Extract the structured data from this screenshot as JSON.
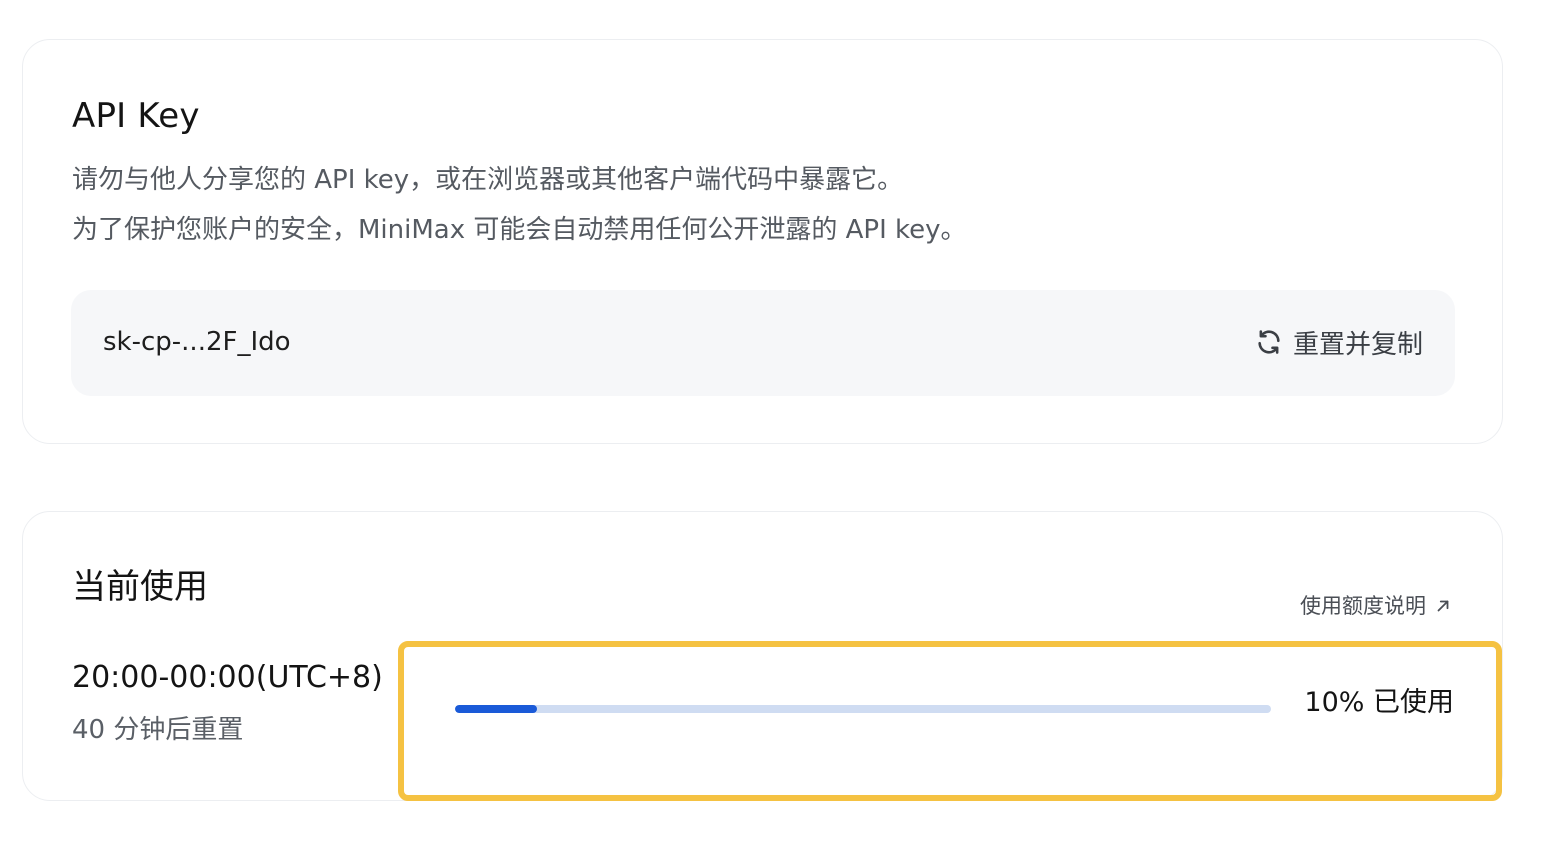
{
  "api_key_card": {
    "title": "API Key",
    "description_line1": "请勿与他人分享您的 API key，或在浏览器或其他客户端代码中暴露它。",
    "description_line2": "为了保护您账户的安全，MiniMax 可能会自动禁用任何公开泄露的 API key。",
    "key_value": "sk-cp-...2F_Ido",
    "reset_button_label": "重置并复制",
    "reset_icon": "refresh-icon"
  },
  "usage_card": {
    "title": "当前使用",
    "quota_link_label": "使用额度说明",
    "quota_link_icon": "arrow-up-right-icon",
    "time_range": "20:00-00:00(UTC+8)",
    "reset_hint": "40 分钟后重置",
    "usage_percent": 10,
    "usage_label": "10% 已使用"
  },
  "colors": {
    "progress_fill": "#1a5ad8",
    "progress_track": "#cfdcf2",
    "highlight_border": "#f5c242",
    "key_box_bg": "#f6f7f9"
  }
}
